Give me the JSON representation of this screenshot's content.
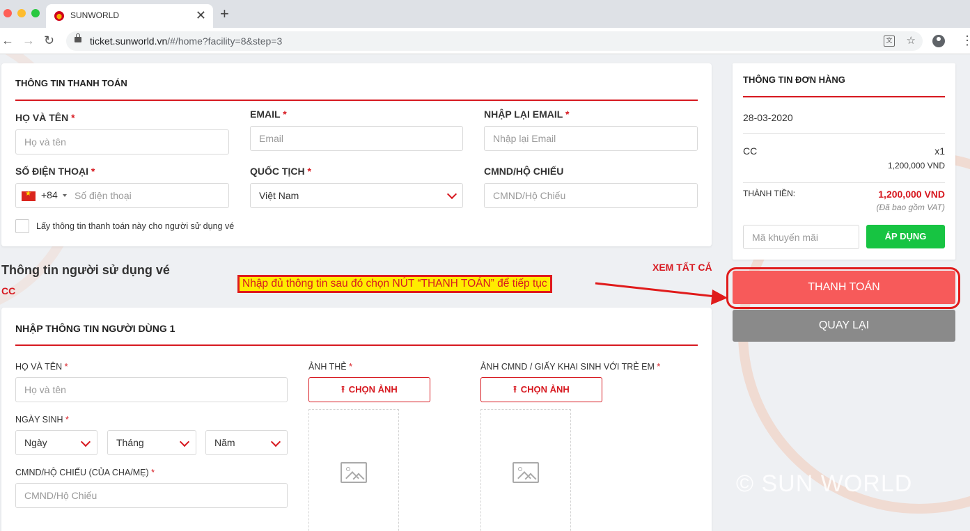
{
  "browser": {
    "tab_title": "SUNWORLD",
    "tab_close": "✕",
    "new_tab": "+",
    "url_host": "ticket.sunworld.vn",
    "url_path": "/#/home?facility=8&step=3",
    "icons": [
      "back-arrow-icon",
      "forward-arrow-icon",
      "reload-icon",
      "lock-icon",
      "translate-icon",
      "star-icon",
      "profile-icon",
      "menu-icon"
    ]
  },
  "payment": {
    "title": "THÔNG TIN THANH TOÁN",
    "fullname_label": "HỌ VÀ TÊN",
    "fullname_placeholder": "Họ và tên",
    "email_label": "EMAIL",
    "email_placeholder": "Email",
    "email_confirm_label": "NHẬP LẠI EMAIL",
    "email_confirm_placeholder": "Nhập lại Email",
    "phone_label": "SỐ ĐIỆN THOẠI",
    "phone_code": "+84",
    "phone_placeholder": "Số điện thoại",
    "nationality_label": "QUỐC TỊCH",
    "nationality_value": "Việt Nam",
    "id_label": "CMND/HỘ CHIẾU",
    "id_placeholder": "CMND/Hộ Chiếu",
    "copy_checkbox_label": "Lấy thông tin thanh toán này cho người sử dụng vé",
    "required_mark": "*"
  },
  "users": {
    "heading": "Thông tin người sử dụng vé",
    "ticket_type": "CC",
    "see_all": "XEM TẤT CẢ"
  },
  "user1": {
    "title": "NHẬP THÔNG TIN NGƯỜI DÙNG 1",
    "fullname_label": "HỌ VÀ TÊN",
    "fullname_placeholder": "Họ và tên",
    "dob_label": "NGÀY SINH",
    "day_placeholder": "Ngày",
    "month_placeholder": "Tháng",
    "year_placeholder": "Năm",
    "parent_id_label": "CMND/HỘ CHIẾU (CỦA CHA/MẸ)",
    "parent_id_placeholder": "CMND/Hộ Chiếu",
    "photo_label": "ẢNH THẺ",
    "doc_photo_label": "ẢNH CMND / GIẤY KHAI SINH VỚI TRẺ EM",
    "choose_photo": "CHỌN ẢNH",
    "upload_icon": "⭱",
    "required_mark": "*"
  },
  "order": {
    "title": "THÔNG TIN ĐƠN HÀNG",
    "date": "28-03-2020",
    "item_name": "CC",
    "item_qty": "x1",
    "item_price": "1,200,000 VND",
    "total_label": "THÀNH TIỀN:",
    "total_value": "1,200,000 VND",
    "vat_note": "(Đã bao gồm VAT)",
    "promo_placeholder": "Mã khuyến mãi",
    "apply_button": "ÁP DỤNG",
    "pay_button": "THANH TOÁN",
    "back_button": "QUAY LẠI"
  },
  "annotation": {
    "callout": "Nhập đủ thông tin sau đó chọn NÚT “THANH TOÁN” để tiếp tục"
  },
  "watermark": "© SUN WORLD",
  "colors": {
    "brand_red": "#d71920",
    "pay_button": "#f75a5a",
    "apply_green": "#17c442",
    "back_gray": "#8a8a8a",
    "callout_yellow": "#ffec00"
  }
}
